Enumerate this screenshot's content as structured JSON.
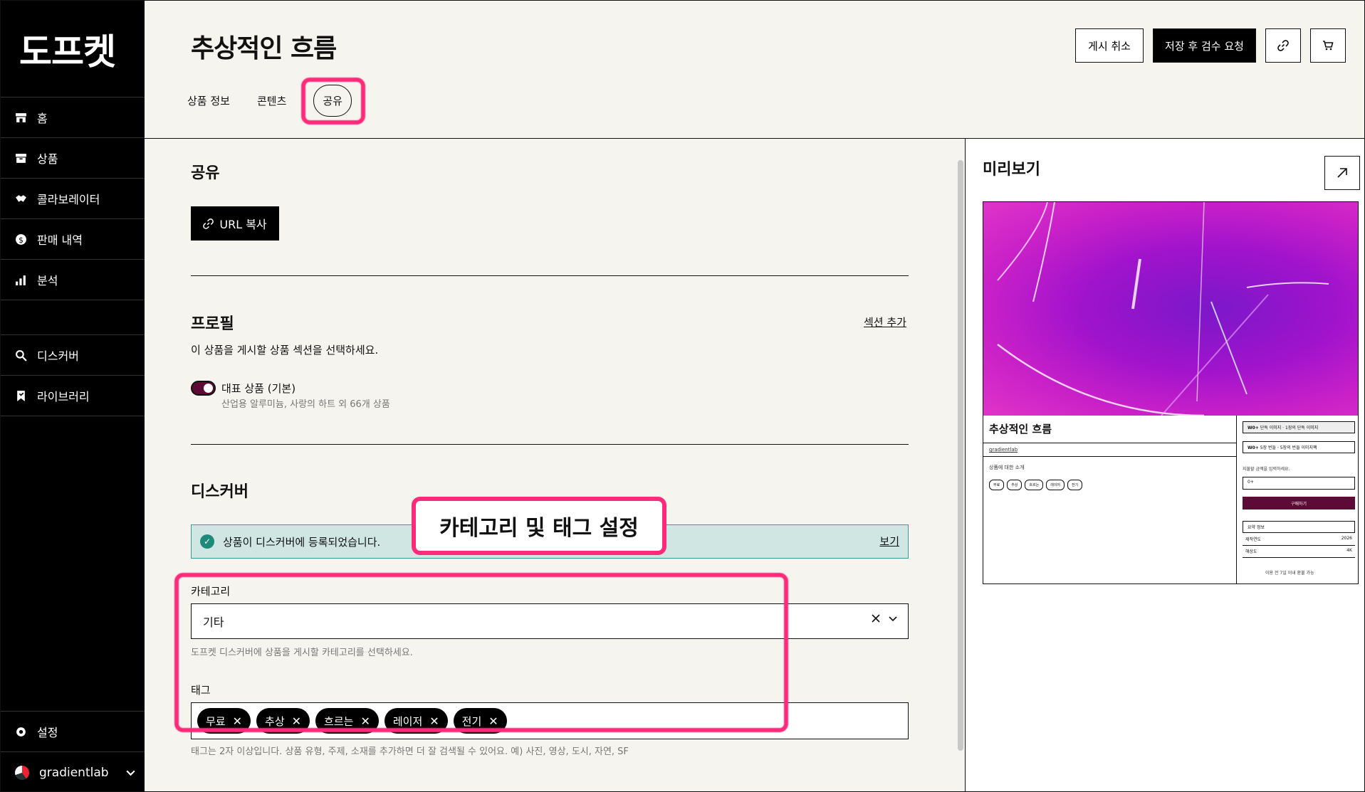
{
  "app": {
    "logo": "도프켓"
  },
  "sidebar": {
    "items": [
      {
        "label": "홈",
        "icon": "store-icon"
      },
      {
        "label": "상품",
        "icon": "box-icon"
      },
      {
        "label": "콜라보레이터",
        "icon": "handshake-icon"
      },
      {
        "label": "판매 내역",
        "icon": "dollar-icon"
      },
      {
        "label": "분석",
        "icon": "bar-chart-icon"
      },
      {
        "label": "디스커버",
        "icon": "search-icon"
      },
      {
        "label": "라이브러리",
        "icon": "bookmark-icon"
      }
    ],
    "settings_label": "설정",
    "user": {
      "name": "gradientlab"
    }
  },
  "header": {
    "title": "추상적인 흐름",
    "tabs": [
      {
        "label": "상품 정보",
        "active": false
      },
      {
        "label": "콘텐츠",
        "active": false
      },
      {
        "label": "공유",
        "active": true
      }
    ],
    "buttons": {
      "unpublish": "게시 취소",
      "save_review": "저장 후 검수 요청"
    }
  },
  "share": {
    "heading": "공유",
    "copy_url": "URL 복사"
  },
  "profile": {
    "heading": "프로필",
    "add_section": "섹션 추가",
    "description": "이 상품을 게시할 상품 섹션을 선택하세요.",
    "section_name": "대표 상품 (기본)",
    "section_sub": "산업용 알루미늄, 사랑의 하트 외 66개 상품",
    "enabled": true
  },
  "discover": {
    "heading": "디스커버",
    "banner": "상품이 디스커버에 등록되었습니다.",
    "view_link": "보기",
    "category_label": "카테고리",
    "category_value": "기타",
    "category_help": "도프켓 디스커버에 상품을 게시할 카테고리를 선택하세요.",
    "tags_label": "태그",
    "tags": [
      "무료",
      "추상",
      "흐르는",
      "레이저",
      "전기"
    ],
    "tags_help": "태그는 2자 이상입니다. 상품 유형, 주제, 소재를 추가하면 더 잘 검색될 수 있어요. 예) 사진, 영상, 도시, 자연, SF"
  },
  "annotation": {
    "callout": "카테고리 및 태그 설정"
  },
  "preview": {
    "heading": "미리보기",
    "product_title": "추상적인 흐름",
    "creator": "gradientlab",
    "about": "상품에 대한 소개",
    "chips": [
      "무료",
      "추상",
      "흐르는",
      "레이저",
      "전기"
    ],
    "options": [
      {
        "price": "W0+",
        "name": "단독 이미지",
        "sub": "1장의 단독 이미지"
      },
      {
        "price": "W0+",
        "name": "5장 번들",
        "sub": "5장의 번들 이미지팩"
      }
    ],
    "price_prompt": "지불할 금액을 입력하세요.",
    "price_placeholder": "0+",
    "buy_label": "구매하기",
    "info_heading": "요약 정보",
    "info_rows": [
      {
        "key": "제작연도",
        "value": "2026"
      },
      {
        "key": "해상도",
        "value": "4K"
      }
    ],
    "footer": "이용 전 7일 이내 환불 가능"
  },
  "colors": {
    "accent": "#5d0a36",
    "highlight": "#ff2a7a",
    "banner_bg": "#cfe6e3",
    "panel_bg": "#f5f4ef"
  }
}
